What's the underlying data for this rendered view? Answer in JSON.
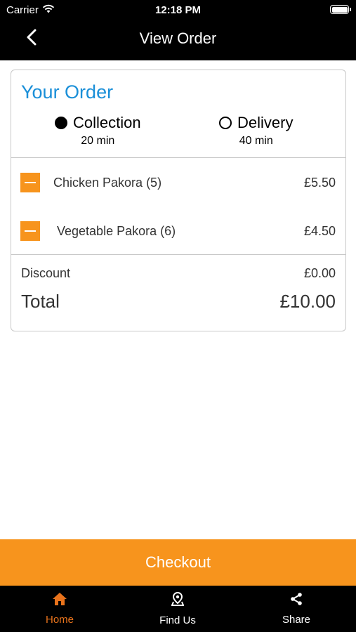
{
  "status_bar": {
    "carrier": "Carrier",
    "time": "12:18 PM"
  },
  "nav": {
    "title": "View Order"
  },
  "order": {
    "title": "Your Order",
    "options": [
      {
        "label": "Collection",
        "time": "20 min",
        "selected": true
      },
      {
        "label": "Delivery",
        "time": "40 min",
        "selected": false
      }
    ],
    "items": [
      {
        "name": "Chicken Pakora (5)",
        "price": "£5.50"
      },
      {
        "name": "Vegetable Pakora (6)",
        "price": "£4.50"
      }
    ],
    "discount_label": "Discount",
    "discount_value": "£0.00",
    "total_label": "Total",
    "total_value": "£10.00"
  },
  "checkout_label": "Checkout",
  "tabs": [
    {
      "label": "Home",
      "icon": "home-icon",
      "active": true
    },
    {
      "label": "Find Us",
      "icon": "location-pin-icon",
      "active": false
    },
    {
      "label": "Share",
      "icon": "share-icon",
      "active": false
    }
  ],
  "colors": {
    "accent": "#f7941d",
    "active_tab": "#e8731c",
    "title_blue": "#1a8fd8",
    "bar_background": "#000000"
  }
}
